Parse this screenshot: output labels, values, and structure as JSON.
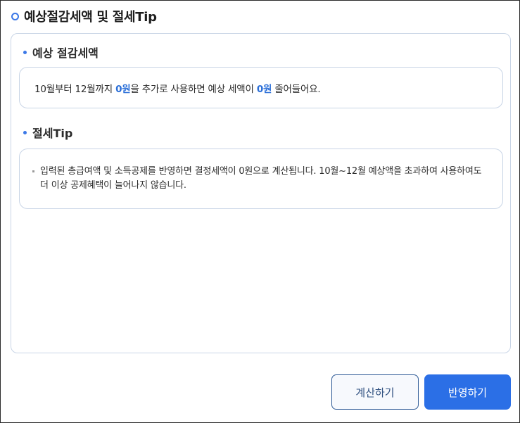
{
  "dialog": {
    "title": "예상절감세액 및 절세Tip"
  },
  "estimate": {
    "title": "예상 절감세액",
    "sentence": {
      "part1": "10월부터 12월까지 ",
      "amount1": "0원",
      "part2": "을 추가로 사용하면 예상 세액이 ",
      "amount2": "0원",
      "part3": " 줄어들어요."
    }
  },
  "tip": {
    "title": "절세Tip",
    "items": [
      "입력된 총급여액 및 소득공제를 반영하면 결정세액이 0원으로 계산됩니다. 10월~12월 예상액을 초과하여 사용하여도 더 이상 공제혜택이 늘어나지 않습니다."
    ]
  },
  "actions": {
    "calculate_label": "계산하기",
    "apply_label": "반영하기"
  },
  "colors": {
    "accent": "#2b6fe6",
    "highlight": "#2b6fd8",
    "border": "#c9d5e6"
  },
  "icons": {
    "title_marker": "ring-icon",
    "section_marker": "dot-icon",
    "tip_bullet": "square-bullet-icon"
  }
}
